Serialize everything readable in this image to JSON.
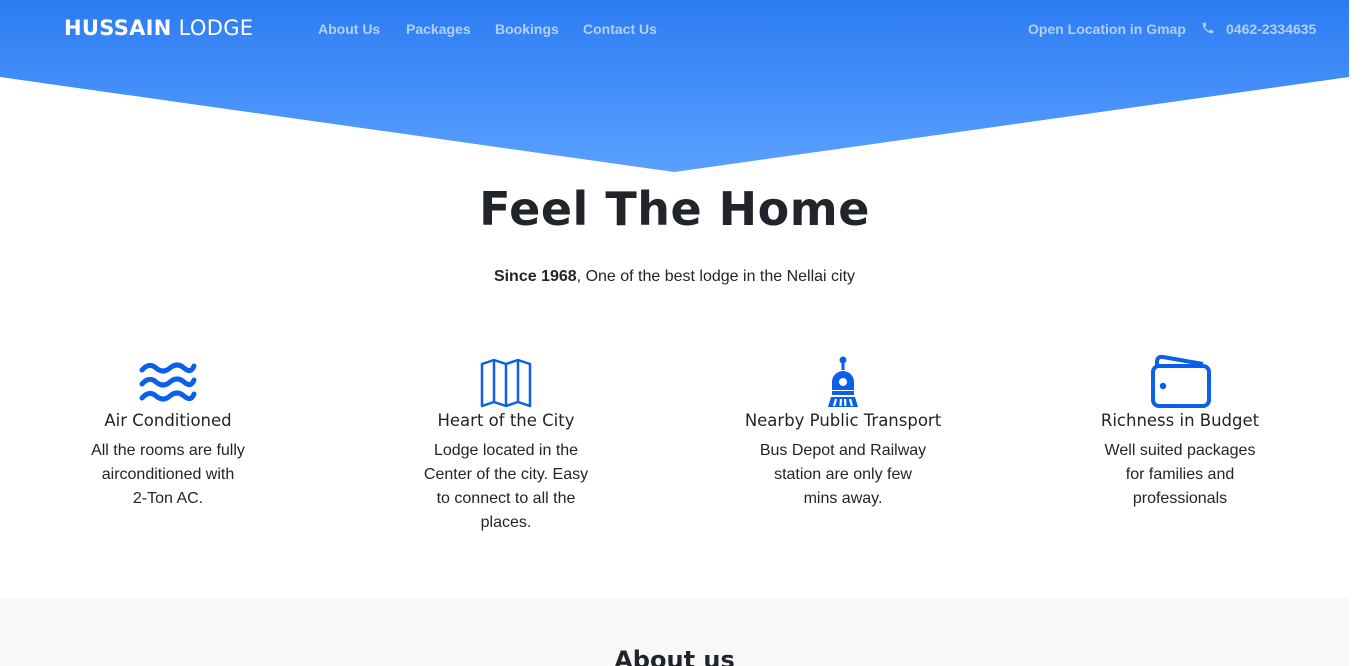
{
  "header": {
    "brand_bold": "HUSSAIN",
    "brand_light": "LODGE",
    "nav": [
      "About Us",
      "Packages",
      "Bookings",
      "Contact Us"
    ],
    "gmap_link": "Open Location in Gmap",
    "phone": "0462-2334635",
    "phone_icon": "phone-icon"
  },
  "hero": {
    "title": "Feel The Home",
    "subtitle_bold": "Since 1968",
    "subtitle_rest": ", One of the best lodge in the Nellai city"
  },
  "features": [
    {
      "icon": "waves-icon",
      "title": "Air Conditioned",
      "lines": [
        "All the rooms are fully",
        "airconditioned with",
        "2-Ton AC."
      ]
    },
    {
      "icon": "map-icon",
      "title": "Heart of the City",
      "lines": [
        "Lodge located in the",
        "Center of the city. Easy",
        "to connect to all the",
        "places."
      ]
    },
    {
      "icon": "train-icon",
      "title": "Nearby Public Transport",
      "lines": [
        "Bus Depot and Railway",
        "station are only few",
        "mins away."
      ]
    },
    {
      "icon": "wallet-icon",
      "title": "Richness in Budget",
      "lines": [
        "Well suited packages",
        "for families and",
        "professionals"
      ]
    }
  ],
  "about": {
    "title": "About us"
  },
  "colors": {
    "accent": "#0b5fe8",
    "hero_top": "#2c7cf2",
    "hero_bottom": "#5aa0ff"
  }
}
